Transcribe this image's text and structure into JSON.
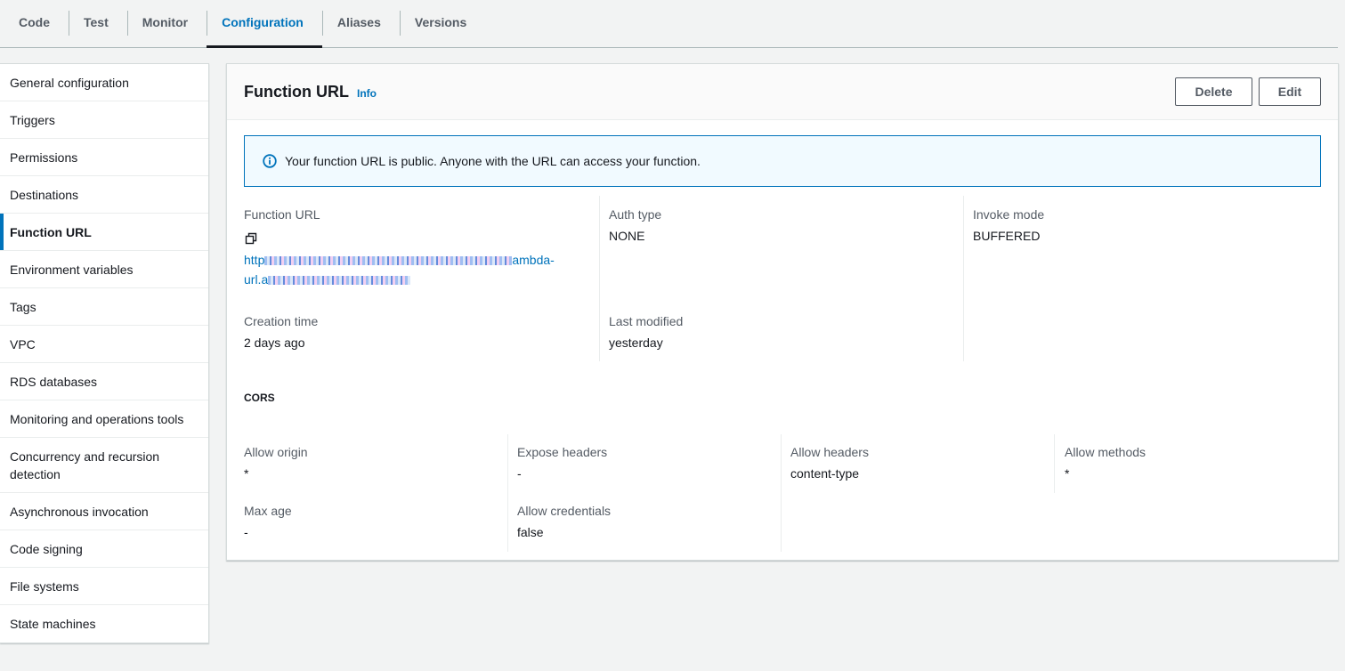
{
  "tabs": [
    {
      "label": "Code"
    },
    {
      "label": "Test"
    },
    {
      "label": "Monitor"
    },
    {
      "label": "Configuration",
      "active": true
    },
    {
      "label": "Aliases"
    },
    {
      "label": "Versions"
    }
  ],
  "sidebar": {
    "items": [
      {
        "label": "General configuration"
      },
      {
        "label": "Triggers"
      },
      {
        "label": "Permissions"
      },
      {
        "label": "Destinations"
      },
      {
        "label": "Function URL",
        "active": true
      },
      {
        "label": "Environment variables"
      },
      {
        "label": "Tags"
      },
      {
        "label": "VPC"
      },
      {
        "label": "RDS databases"
      },
      {
        "label": "Monitoring and operations tools"
      },
      {
        "label": "Concurrency and recursion detection"
      },
      {
        "label": "Asynchronous invocation"
      },
      {
        "label": "Code signing"
      },
      {
        "label": "File systems"
      },
      {
        "label": "State machines"
      }
    ]
  },
  "panel": {
    "title": "Function URL",
    "info": "Info",
    "delete_label": "Delete",
    "edit_label": "Edit",
    "alert_text": "Your function URL is public. Anyone with the URL can access your function.",
    "function_url_label": "Function URL",
    "function_url_prefix": "http",
    "function_url_mid": "ambda-",
    "function_url_line2": "url.a",
    "auth_type_label": "Auth type",
    "auth_type_value": "NONE",
    "invoke_mode_label": "Invoke mode",
    "invoke_mode_value": "BUFFERED",
    "creation_time_label": "Creation time",
    "creation_time_value": "2 days ago",
    "last_modified_label": "Last modified",
    "last_modified_value": "yesterday",
    "cors_title": "CORS",
    "allow_origin_label": "Allow origin",
    "allow_origin_value": "*",
    "expose_headers_label": "Expose headers",
    "expose_headers_value": "-",
    "allow_headers_label": "Allow headers",
    "allow_headers_value": "content-type",
    "allow_methods_label": "Allow methods",
    "allow_methods_value": "*",
    "max_age_label": "Max age",
    "max_age_value": "-",
    "allow_credentials_label": "Allow credentials",
    "allow_credentials_value": "false"
  },
  "colors": {
    "accent": "#0073bb",
    "alert_bg": "#f1faff",
    "page_bg": "#f2f3f3"
  }
}
